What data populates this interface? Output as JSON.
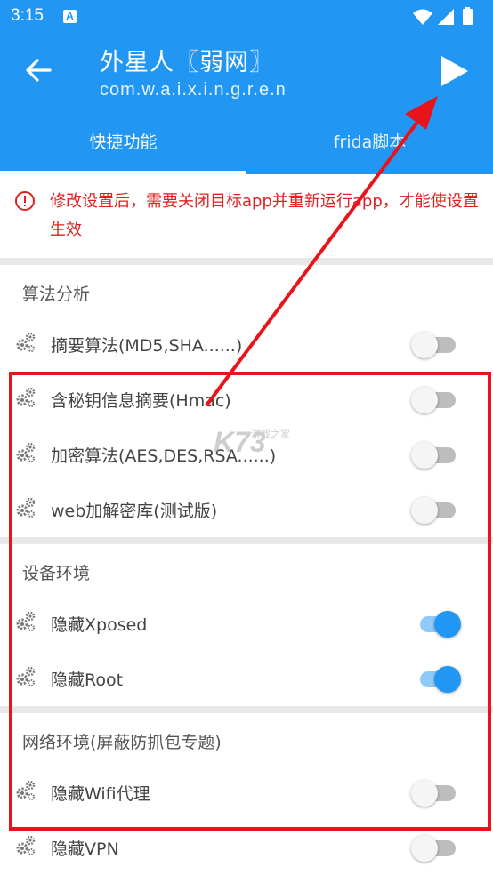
{
  "status_bar": {
    "time": "3:15",
    "notification_icon": "A"
  },
  "app_bar": {
    "title": "外星人〖弱网〗",
    "subtitle": "com.w.a.i.x.i.n.g.r.e.n"
  },
  "tabs": [
    {
      "label": "快捷功能",
      "selected": true
    },
    {
      "label": "frida脚本",
      "selected": false
    }
  ],
  "warning": {
    "text": "修改设置后，需要关闭目标app并重新运行app，才能使设置生效",
    "color": "#e02020"
  },
  "sections": [
    {
      "title": "算法分析",
      "items": [
        {
          "label": "摘要算法(MD5,SHA......)",
          "enabled": false
        },
        {
          "label": "含秘钥信息摘要(Hmac)",
          "enabled": false
        },
        {
          "label": "加密算法(AES,DES,RSA......)",
          "enabled": false
        },
        {
          "label": "web加解密库(测试版)",
          "enabled": false
        }
      ]
    },
    {
      "title": "设备环境",
      "items": [
        {
          "label": "隐藏Xposed",
          "enabled": true
        },
        {
          "label": "隐藏Root",
          "enabled": true
        }
      ]
    },
    {
      "title": "网络环境(屏蔽防抓包专题)",
      "items": [
        {
          "label": "隐藏Wifi代理",
          "enabled": false
        },
        {
          "label": "隐藏VPN",
          "enabled": false
        }
      ]
    }
  ],
  "colors": {
    "primary": "#2196f3",
    "annotation": "#e8141c",
    "switch_on": "#2196f3",
    "switch_off": "#f5f5f5"
  },
  "watermark": {
    "text": "K73",
    "subtext": "游戏之家"
  }
}
